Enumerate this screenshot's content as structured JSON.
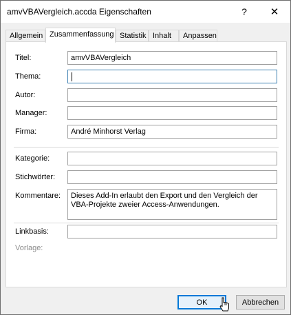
{
  "window": {
    "title": "amvVBAVergleich.accda Eigenschaften",
    "help_label": "?",
    "close_label": "✕"
  },
  "tabs": [
    {
      "label": "Allgemein",
      "active": false
    },
    {
      "label": "Zusammenfassung",
      "active": true
    },
    {
      "label": "Statistik",
      "active": false
    },
    {
      "label": "Inhalt",
      "active": false
    },
    {
      "label": "Anpassen",
      "active": false
    }
  ],
  "form": {
    "titel": {
      "label": "Titel:",
      "value": "amvVBAVergleich"
    },
    "thema": {
      "label": "Thema:",
      "value": ""
    },
    "autor": {
      "label": "Autor:",
      "value": ""
    },
    "manager": {
      "label": "Manager:",
      "value": ""
    },
    "firma": {
      "label": "Firma:",
      "value": "André Minhorst Verlag"
    },
    "kategorie": {
      "label": "Kategorie:",
      "value": ""
    },
    "stichwoerter": {
      "label": "Stichwörter:",
      "value": ""
    },
    "kommentare": {
      "label": "Kommentare:",
      "value": "Dieses Add-In erlaubt den Export und den Vergleich der VBA-Projekte zweier Access-Anwendungen."
    },
    "linkbasis": {
      "label": "Linkbasis:",
      "value": ""
    },
    "vorlage": {
      "label": "Vorlage:"
    }
  },
  "buttons": {
    "ok": "OK",
    "cancel": "Abbrechen"
  }
}
